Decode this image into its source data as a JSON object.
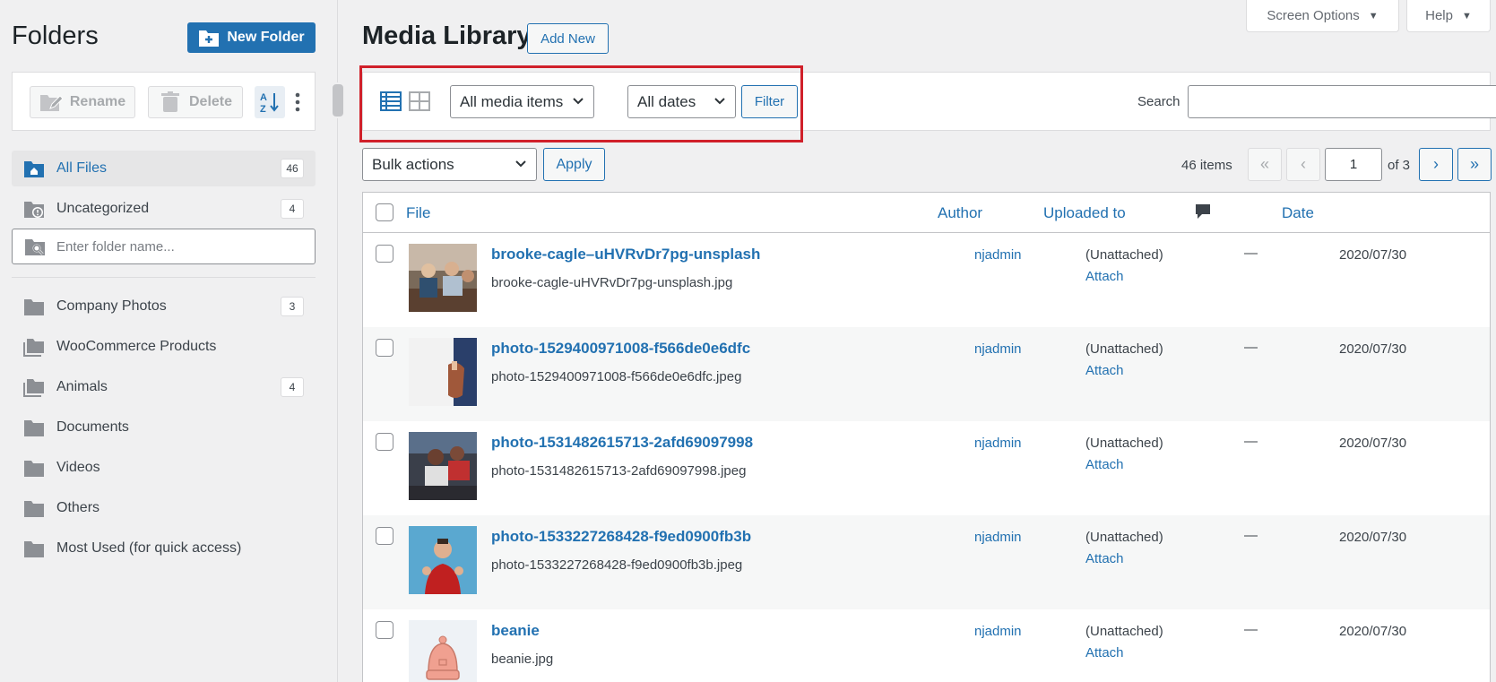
{
  "sidebar": {
    "title": "Folders",
    "new_folder_label": "New Folder",
    "rename_label": "Rename",
    "delete_label": "Delete",
    "search_placeholder": "Enter folder name...",
    "items": [
      {
        "label": "All Files",
        "count": "46",
        "icon": "home-folder-icon"
      },
      {
        "label": "Uncategorized",
        "count": "4",
        "icon": "uncategorized-folder-icon"
      },
      {
        "label": "Company Photos",
        "count": "3",
        "icon": "folder-icon"
      },
      {
        "label": "WooCommerce Products",
        "count": "",
        "icon": "multi-folder-icon"
      },
      {
        "label": "Animals",
        "count": "4",
        "icon": "multi-folder-icon"
      },
      {
        "label": "Documents",
        "count": "",
        "icon": "folder-icon"
      },
      {
        "label": "Videos",
        "count": "",
        "icon": "folder-icon"
      },
      {
        "label": "Others",
        "count": "",
        "icon": "folder-icon"
      },
      {
        "label": "Most Used (for quick access)",
        "count": "",
        "icon": "folder-icon"
      }
    ]
  },
  "header": {
    "title": "Media Library",
    "add_new_label": "Add New",
    "screen_options_label": "Screen Options",
    "help_label": "Help"
  },
  "filters": {
    "media_type": "All media items",
    "dates": "All dates",
    "filter_label": "Filter",
    "search_label": "Search",
    "search_value": ""
  },
  "tablenav": {
    "bulk_actions": "Bulk actions",
    "apply_label": "Apply",
    "items_count": "46 items",
    "first": "«",
    "prev": "‹",
    "current_page": "1",
    "of_pages": "of 3",
    "next": "›",
    "last": "»"
  },
  "table": {
    "columns": {
      "file": "File",
      "author": "Author",
      "uploaded_to": "Uploaded to",
      "date": "Date"
    },
    "rows": [
      {
        "title": "brooke-cagle–uHVRvDr7pg-unsplash",
        "filename": "brooke-cagle-uHVRvDr7pg-unsplash.jpg",
        "author": "njadmin",
        "uploaded": "(Unattached)",
        "attach": "Attach",
        "comments": "—",
        "date": "2020/07/30"
      },
      {
        "title": "photo-1529400971008-f566de0e6dfc",
        "filename": "photo-1529400971008-f566de0e6dfc.jpeg",
        "author": "njadmin",
        "uploaded": "(Unattached)",
        "attach": "Attach",
        "comments": "—",
        "date": "2020/07/30"
      },
      {
        "title": "photo-1531482615713-2afd69097998",
        "filename": "photo-1531482615713-2afd69097998.jpeg",
        "author": "njadmin",
        "uploaded": "(Unattached)",
        "attach": "Attach",
        "comments": "—",
        "date": "2020/07/30"
      },
      {
        "title": "photo-1533227268428-f9ed0900fb3b",
        "filename": "photo-1533227268428-f9ed0900fb3b.jpeg",
        "author": "njadmin",
        "uploaded": "(Unattached)",
        "attach": "Attach",
        "comments": "—",
        "date": "2020/07/30"
      },
      {
        "title": "beanie",
        "filename": "beanie.jpg",
        "author": "njadmin",
        "uploaded": "(Unattached)",
        "attach": "Attach",
        "comments": "—",
        "date": "2020/07/30"
      }
    ]
  },
  "colors": {
    "accent": "#2271b1",
    "highlight_box": "#d0202a"
  }
}
